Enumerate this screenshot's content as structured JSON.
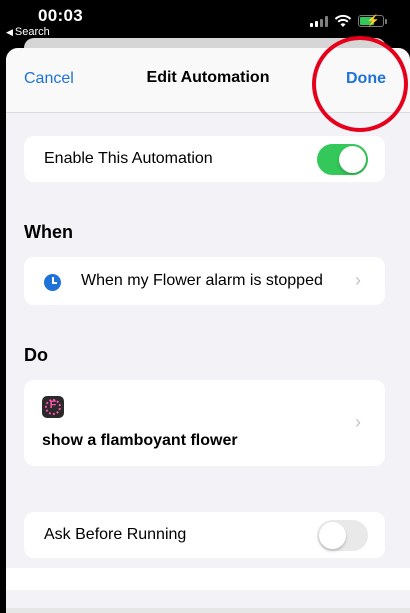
{
  "status_bar": {
    "time": "00:03",
    "back_label": "Search"
  },
  "nav": {
    "cancel_label": "Cancel",
    "title": "Edit Automation",
    "done_label": "Done"
  },
  "enable_row": {
    "label": "Enable This Automation",
    "enabled": true
  },
  "when": {
    "header": "When",
    "trigger_label": "When my Flower alarm is stopped"
  },
  "do": {
    "header": "Do",
    "action_icon_letter": "F",
    "action_label": "show a flamboyant flower"
  },
  "ask_row": {
    "label": "Ask Before Running",
    "enabled": false
  },
  "colors": {
    "accent": "#1e72d8",
    "toggle_on": "#34c759",
    "annotation": "#e5001c",
    "flower": "#ff4fb0"
  },
  "icons": [
    "signal-icon",
    "wifi-icon",
    "battery-icon",
    "clock-icon",
    "flower-app-icon",
    "chevron-right-icon"
  ]
}
